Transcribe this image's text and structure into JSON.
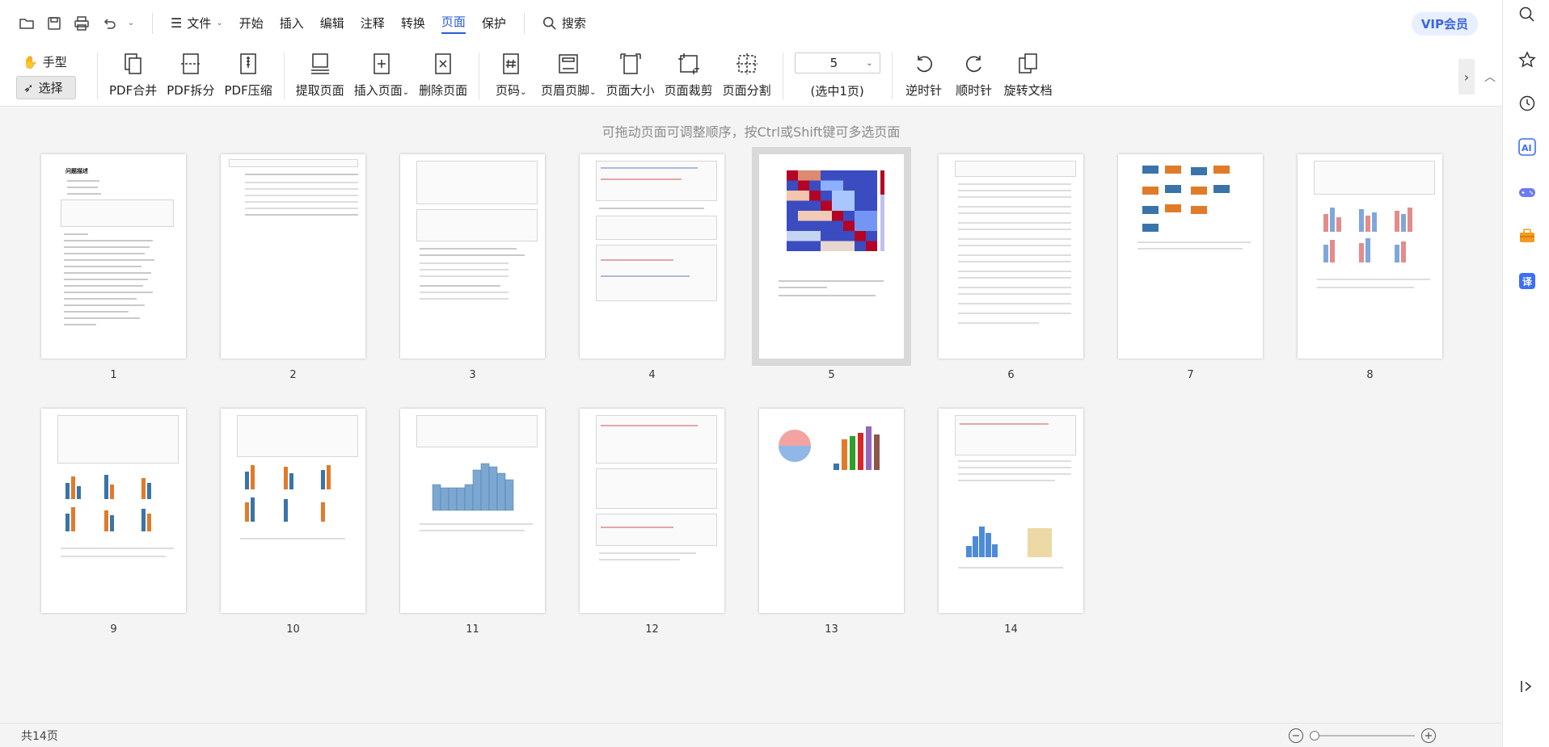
{
  "menubar": {
    "items": [
      "文件",
      "开始",
      "插入",
      "编辑",
      "注释",
      "转换",
      "页面",
      "保护"
    ],
    "active": "页面",
    "search_label": "搜索",
    "vip_label": "VIP会员"
  },
  "ribbon": {
    "modes": {
      "hand": "手型",
      "select": "选择"
    },
    "buttons": {
      "merge": "PDF合并",
      "split": "PDF拆分",
      "compress": "PDF压缩",
      "extract": "提取页面",
      "insert": "插入页面",
      "delete": "删除页面",
      "pagenum": "页码",
      "headerfooter": "页眉页脚",
      "pagesize": "页面大小",
      "crop": "页面裁剪",
      "pagesplit": "页面分割",
      "rotate_ccw": "逆时针",
      "rotate_cw": "顺时针",
      "rotate_doc": "旋转文档"
    },
    "page_select_value": "5",
    "page_select_label": "(选中1页)"
  },
  "workspace": {
    "hint": "可拖动页面可调整顺序，按Ctrl或Shift键可多选页面",
    "pages": [
      "1",
      "2",
      "3",
      "4",
      "5",
      "6",
      "7",
      "8",
      "9",
      "10",
      "11",
      "12",
      "13",
      "14"
    ],
    "selected_page": "5",
    "page1_title": "问题描述"
  },
  "status": {
    "page_count": "共14页"
  },
  "colors": {
    "accent": "#2a5bd7",
    "vip_bg": "#e8efff",
    "workspace_bg": "#f4f4f4"
  }
}
